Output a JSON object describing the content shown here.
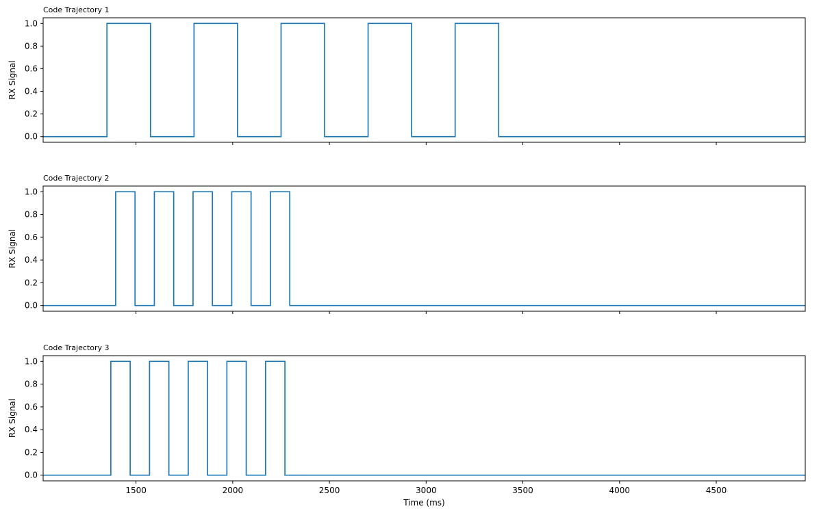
{
  "chart_data": [
    {
      "type": "line",
      "title": "Code Trajectory 1",
      "ylabel": "RX Signal",
      "xlabel": "",
      "show_x_tick_labels": false,
      "xlim": [
        1020,
        4960
      ],
      "ylim": [
        -0.05,
        1.05
      ],
      "x_ticks": [
        1500,
        2000,
        2500,
        3000,
        3500,
        4000,
        4500
      ],
      "y_ticks": [
        "0.0",
        "0.2",
        "0.4",
        "0.6",
        "0.8",
        "1.0"
      ],
      "series": [
        {
          "x": [
            1020,
            1350,
            1350,
            1575,
            1575,
            1800,
            1800,
            2025,
            2025,
            2250,
            2250,
            2475,
            2475,
            2700,
            2700,
            2925,
            2925,
            3150,
            3150,
            3375,
            3375,
            4960
          ],
          "y": [
            0,
            0,
            1,
            1,
            0,
            0,
            1,
            1,
            0,
            0,
            1,
            1,
            0,
            0,
            1,
            1,
            0,
            0,
            1,
            1,
            0,
            0
          ]
        }
      ]
    },
    {
      "type": "line",
      "title": "Code Trajectory 2",
      "ylabel": "RX Signal",
      "xlabel": "",
      "show_x_tick_labels": false,
      "xlim": [
        1020,
        4960
      ],
      "ylim": [
        -0.05,
        1.05
      ],
      "x_ticks": [
        1500,
        2000,
        2500,
        3000,
        3500,
        4000,
        4500
      ],
      "y_ticks": [
        "0.0",
        "0.2",
        "0.4",
        "0.6",
        "0.8",
        "1.0"
      ],
      "series": [
        {
          "x": [
            1020,
            1395,
            1395,
            1495,
            1495,
            1595,
            1595,
            1695,
            1695,
            1795,
            1795,
            1895,
            1895,
            1995,
            1995,
            2095,
            2095,
            2195,
            2195,
            2295,
            2295,
            4960
          ],
          "y": [
            0,
            0,
            1,
            1,
            0,
            0,
            1,
            1,
            0,
            0,
            1,
            1,
            0,
            0,
            1,
            1,
            0,
            0,
            1,
            1,
            0,
            0
          ]
        }
      ]
    },
    {
      "type": "line",
      "title": "Code Trajectory 3",
      "ylabel": "RX Signal",
      "xlabel": "Time (ms)",
      "show_x_tick_labels": true,
      "xlim": [
        1020,
        4960
      ],
      "ylim": [
        -0.05,
        1.05
      ],
      "x_ticks": [
        1500,
        2000,
        2500,
        3000,
        3500,
        4000,
        4500
      ],
      "y_ticks": [
        "0.0",
        "0.2",
        "0.4",
        "0.6",
        "0.8",
        "1.0"
      ],
      "series": [
        {
          "x": [
            1020,
            1370,
            1370,
            1470,
            1470,
            1570,
            1570,
            1670,
            1670,
            1770,
            1770,
            1870,
            1870,
            1970,
            1970,
            2070,
            2070,
            2170,
            2170,
            2270,
            2270,
            4960
          ],
          "y": [
            0,
            0,
            1,
            1,
            0,
            0,
            1,
            1,
            0,
            0,
            1,
            1,
            0,
            0,
            1,
            1,
            0,
            0,
            1,
            1,
            0,
            0
          ]
        }
      ]
    }
  ],
  "colors": {
    "line": "#1f77b4",
    "axes": "#000000"
  }
}
